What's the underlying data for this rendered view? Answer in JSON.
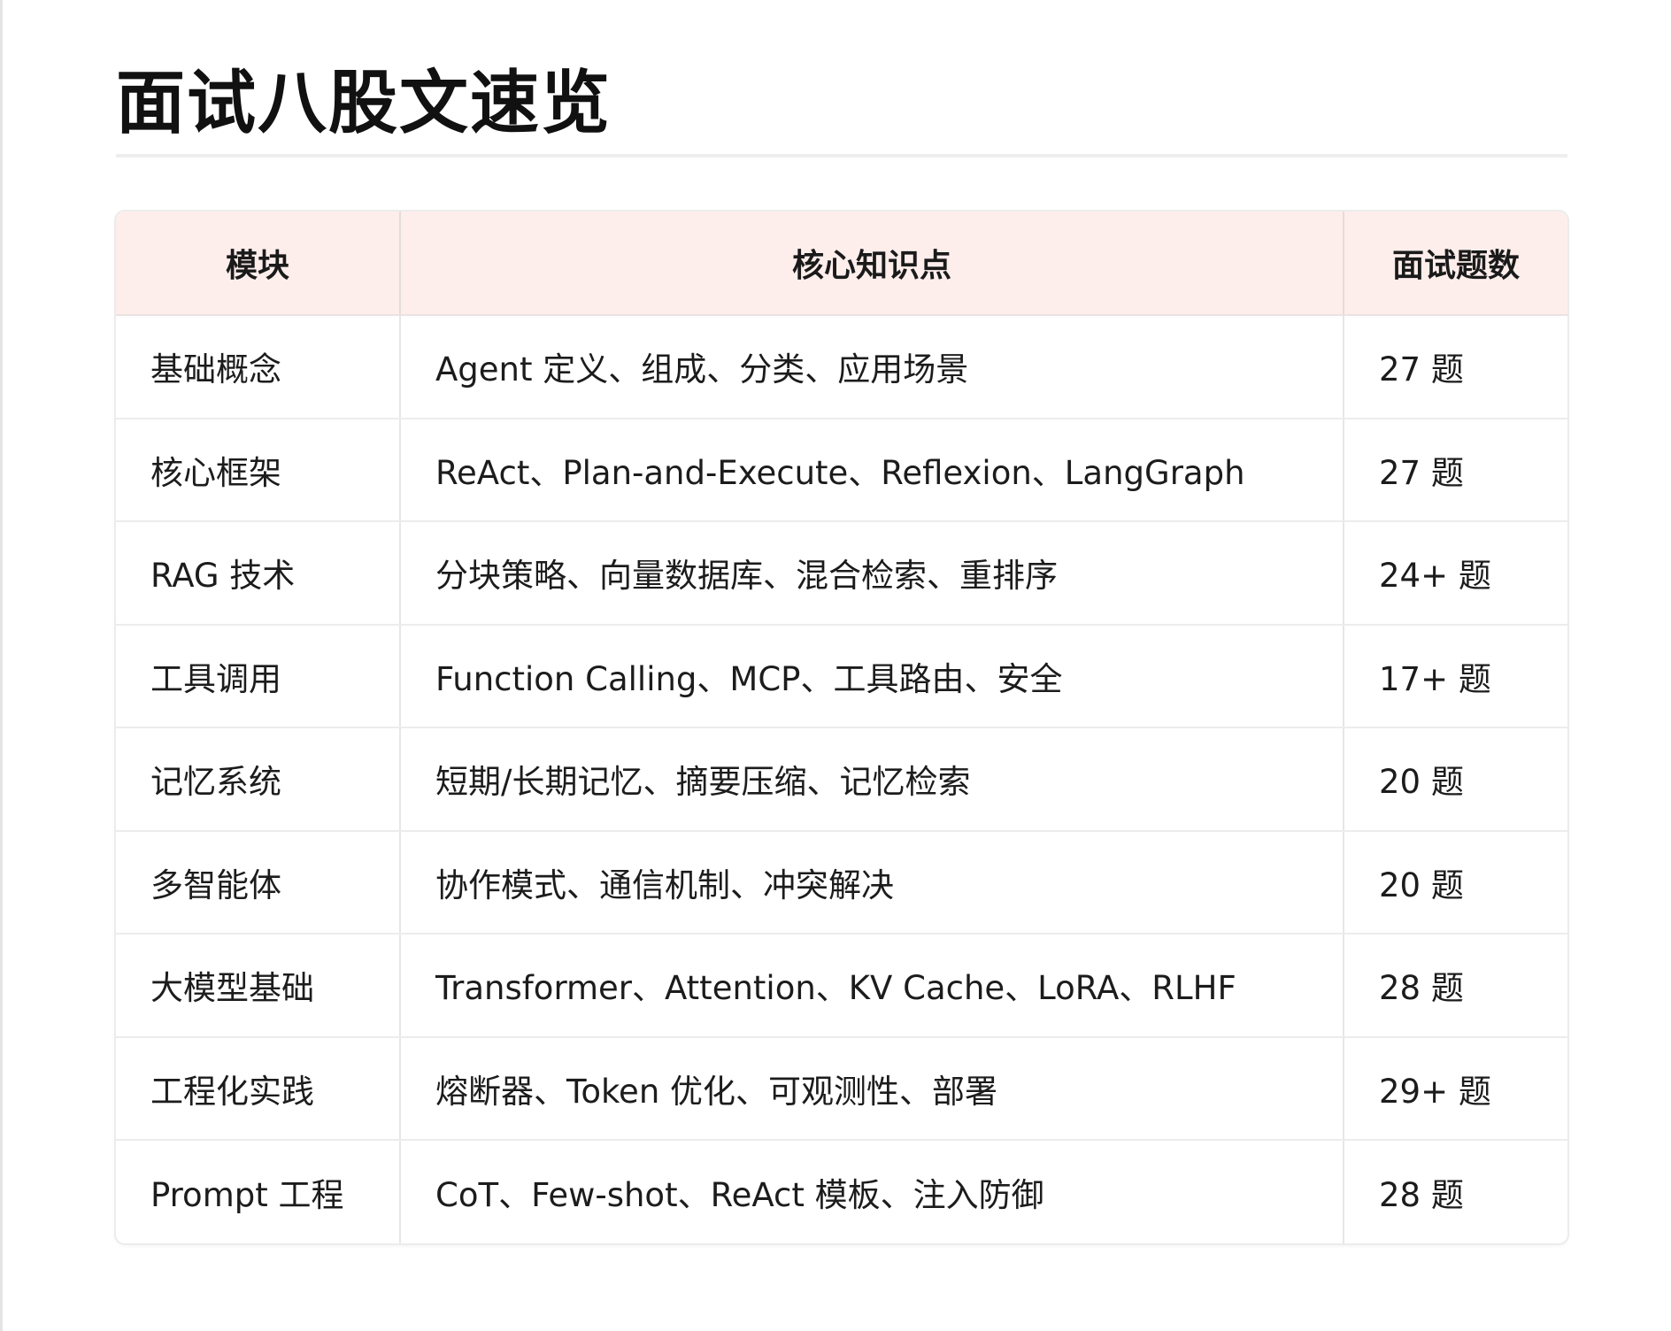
{
  "page": {
    "title": "面试八股文速览"
  },
  "table": {
    "headers": {
      "module": "模块",
      "core_points": "核心知识点",
      "question_count": "面试题数"
    },
    "rows": [
      {
        "module": "基础概念",
        "core_points": "Agent 定义、组成、分类、应用场景",
        "question_count": "27 题"
      },
      {
        "module": "核心框架",
        "core_points": "ReAct、Plan-and-Execute、Reflexion、LangGraph",
        "question_count": "27 题"
      },
      {
        "module": "RAG 技术",
        "core_points": "分块策略、向量数据库、混合检索、重排序",
        "question_count": "24+ 题"
      },
      {
        "module": "工具调用",
        "core_points": "Function Calling、MCP、工具路由、安全",
        "question_count": "17+ 题"
      },
      {
        "module": "记忆系统",
        "core_points": "短期/长期记忆、摘要压缩、记忆检索",
        "question_count": "20 题"
      },
      {
        "module": "多智能体",
        "core_points": "协作模式、通信机制、冲突解决",
        "question_count": "20 题"
      },
      {
        "module": "大模型基础",
        "core_points": "Transformer、Attention、KV Cache、LoRA、RLHF",
        "question_count": "28 题"
      },
      {
        "module": "工程化实践",
        "core_points": "熔断器、Token 优化、可观测性、部署",
        "question_count": "29+ 题"
      },
      {
        "module": "Prompt 工程",
        "core_points": "CoT、Few-shot、ReAct 模板、注入防御",
        "question_count": "28 题"
      }
    ]
  },
  "colors": {
    "header_background": "#fdeeec",
    "border": "#e6e6e6",
    "divider": "#eeeeee",
    "text": "#1c1c1c"
  }
}
